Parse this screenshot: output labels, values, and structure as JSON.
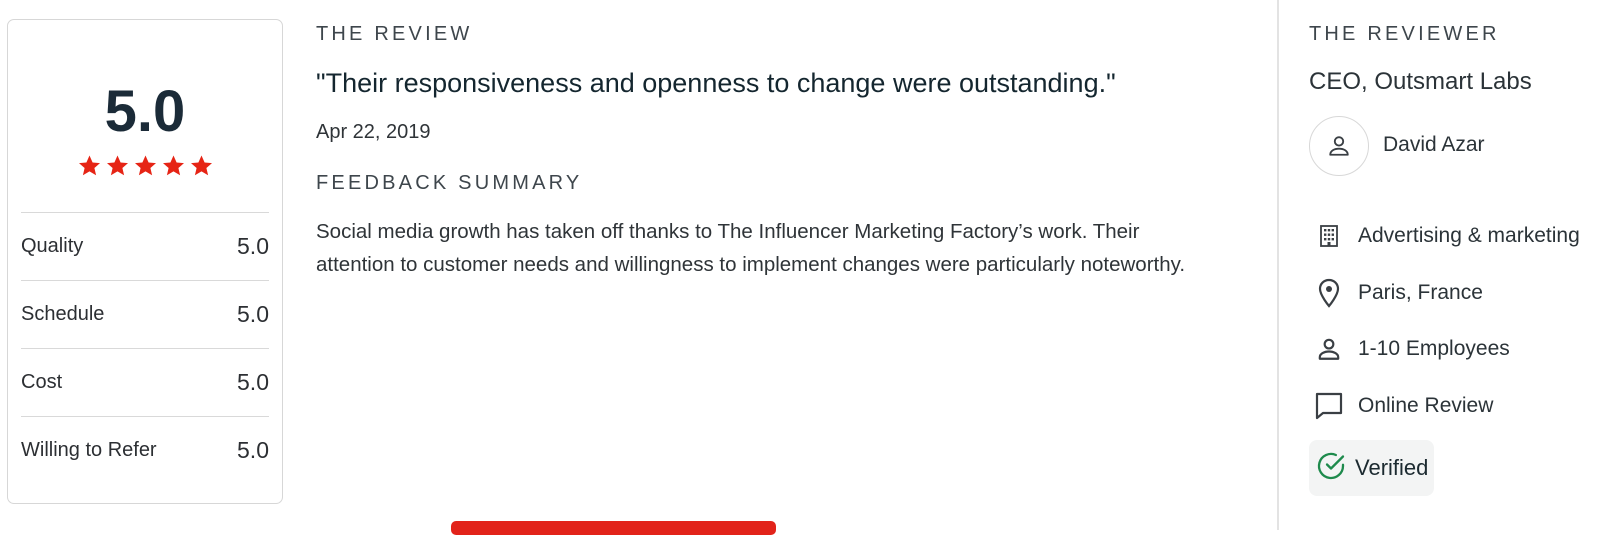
{
  "ratings": {
    "overall": "5.0",
    "stars": 5,
    "star_color": "#e62415",
    "metrics": [
      {
        "label": "Quality",
        "value": "5.0"
      },
      {
        "label": "Schedule",
        "value": "5.0"
      },
      {
        "label": "Cost",
        "value": "5.0"
      },
      {
        "label": "Willing to Refer",
        "value": "5.0"
      }
    ]
  },
  "review": {
    "heading": "THE REVIEW",
    "quote": "\"Their responsiveness and openness to change were outstanding.\"",
    "date": "Apr 22, 2019",
    "summary_heading": "FEEDBACK SUMMARY",
    "summary": "Social media growth has taken off thanks to The Influencer Marketing Factory’s work. Their attention to customer needs and willingness to implement changes were particularly noteworthy."
  },
  "reviewer": {
    "heading": "THE REVIEWER",
    "role": "CEO, Outsmart Labs",
    "name": "David Azar",
    "details": [
      {
        "icon": "building-icon",
        "text": "Advertising & marketing"
      },
      {
        "icon": "location-pin-icon",
        "text": "Paris, France"
      },
      {
        "icon": "person-icon",
        "text": "1-10 Employees"
      },
      {
        "icon": "chat-bubble-icon",
        "text": "Online Review"
      }
    ],
    "verified": {
      "icon": "check-circle-icon",
      "text": "Verified",
      "color": "#1e8a4c"
    }
  },
  "colors": {
    "accent": "#e2231a"
  }
}
